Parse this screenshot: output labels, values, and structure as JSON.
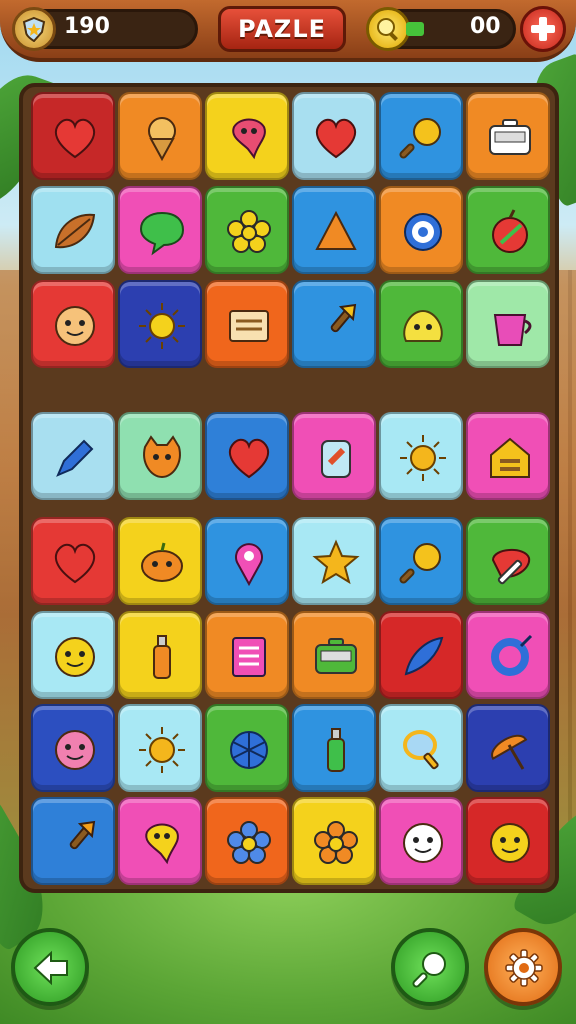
{
  "header": {
    "score": "190",
    "title": "PAZLE",
    "coins": "00"
  },
  "icons": {
    "score_badge": "shield-icon",
    "coin_badge": "coin-icon",
    "add_button": "plus-icon",
    "back_button": "arrow-left-icon",
    "hint_button": "magnifier-icon",
    "settings_button": "gear-icon"
  },
  "board": {
    "rows": [
      [
        {
          "icon": "heart",
          "color": "#c62828",
          "glyph": "#e53935"
        },
        {
          "icon": "ice-cream",
          "color": "#f08a24",
          "glyph": "#f3c060"
        },
        {
          "icon": "bird",
          "color": "#f4d21c",
          "glyph": "#e84d72"
        },
        {
          "icon": "heart",
          "color": "#a8dff0",
          "glyph": "#e53935"
        },
        {
          "icon": "magnifier",
          "color": "#2f93e0",
          "glyph": "#f4c21c"
        },
        {
          "icon": "radio",
          "color": "#f08a24",
          "glyph": "#ffffff"
        }
      ],
      [
        {
          "icon": "leaf",
          "color": "#9fe0f0",
          "glyph": "#c8702a"
        },
        {
          "icon": "chat",
          "color": "#f04fb6",
          "glyph": "#3fbf4a"
        },
        {
          "icon": "flower",
          "color": "#4fb83a",
          "glyph": "#f4d21c"
        },
        {
          "icon": "triangle",
          "color": "#2f93e0",
          "glyph": "#f08a24"
        },
        {
          "icon": "target",
          "color": "#f08a24",
          "glyph": "#2f6fd8"
        },
        {
          "icon": "apple",
          "color": "#4fb83a",
          "glyph": "#e53935"
        }
      ],
      [
        {
          "icon": "face",
          "color": "#e53935",
          "glyph": "#f6c27a"
        },
        {
          "icon": "sun",
          "color": "#2c3fb0",
          "glyph": "#f4d21c"
        },
        {
          "icon": "board",
          "color": "#f0661c",
          "glyph": "#f8e0b0"
        },
        {
          "icon": "brush",
          "color": "#2f93e0",
          "glyph": "#f4c21c"
        },
        {
          "icon": "blob",
          "color": "#4fb83a",
          "glyph": "#f4e040"
        },
        {
          "icon": "cup",
          "color": "#9fe8a8",
          "glyph": "#e84db8"
        }
      ],
      [
        {
          "icon": "pen",
          "color": "#a8dff0",
          "glyph": "#2f6fd8"
        },
        {
          "icon": "cat",
          "color": "#8fe0b0",
          "glyph": "#f08a24"
        },
        {
          "icon": "heart",
          "color": "#2f80d8",
          "glyph": "#e53935"
        },
        {
          "icon": "jar",
          "color": "#f04fb6",
          "glyph": "#c0e8f4"
        },
        {
          "icon": "sun",
          "color": "#a8e8f4",
          "glyph": "#f4b61c"
        },
        {
          "icon": "house",
          "color": "#f04fb6",
          "glyph": "#f4c21c"
        }
      ],
      [
        {
          "icon": "heart",
          "color": "#e53935",
          "glyph": "#e53935"
        },
        {
          "icon": "pumpkin",
          "color": "#f4d21c",
          "glyph": "#f08a24"
        },
        {
          "icon": "pin",
          "color": "#2f93e0",
          "glyph": "#f04fb6"
        },
        {
          "icon": "star",
          "color": "#a8e8f4",
          "glyph": "#f4b61c"
        },
        {
          "icon": "magnifier",
          "color": "#2f93e0",
          "glyph": "#f4c21c"
        },
        {
          "icon": "paint",
          "color": "#4fb83a",
          "glyph": "#e53935"
        }
      ],
      [
        {
          "icon": "face",
          "color": "#a8e8f4",
          "glyph": "#f4d21c"
        },
        {
          "icon": "bottle",
          "color": "#f4d21c",
          "glyph": "#f08a24"
        },
        {
          "icon": "book",
          "color": "#f08a24",
          "glyph": "#f04fb6"
        },
        {
          "icon": "radio",
          "color": "#f08a24",
          "glyph": "#4fb83a"
        },
        {
          "icon": "feather",
          "color": "#d62828",
          "glyph": "#2f6fd8"
        },
        {
          "icon": "ring",
          "color": "#f04fb6",
          "glyph": "#2f6fd8"
        }
      ],
      [
        {
          "icon": "face",
          "color": "#2c4fc0",
          "glyph": "#f080b0"
        },
        {
          "icon": "sun",
          "color": "#a8e8f4",
          "glyph": "#f4b61c"
        },
        {
          "icon": "shell",
          "color": "#4fb83a",
          "glyph": "#2f6fd8"
        },
        {
          "icon": "bottle",
          "color": "#2f93e0",
          "glyph": "#3fbf4a"
        },
        {
          "icon": "mirror",
          "color": "#a8e8f4",
          "glyph": "#f4b61c"
        },
        {
          "icon": "umbrella",
          "color": "#2c3fb0",
          "glyph": "#f08a24"
        }
      ],
      [
        {
          "icon": "brush",
          "color": "#2f80d8",
          "glyph": "#f4a01c"
        },
        {
          "icon": "bird",
          "color": "#f04fb6",
          "glyph": "#f4d21c"
        },
        {
          "icon": "flower",
          "color": "#f0661c",
          "glyph": "#4f8ae8"
        },
        {
          "icon": "flower",
          "color": "#f4d21c",
          "glyph": "#f08a24"
        },
        {
          "icon": "face",
          "color": "#f04fb6",
          "glyph": "#ffffff"
        },
        {
          "icon": "face",
          "color": "#d62828",
          "glyph": "#f4d21c"
        }
      ]
    ]
  }
}
